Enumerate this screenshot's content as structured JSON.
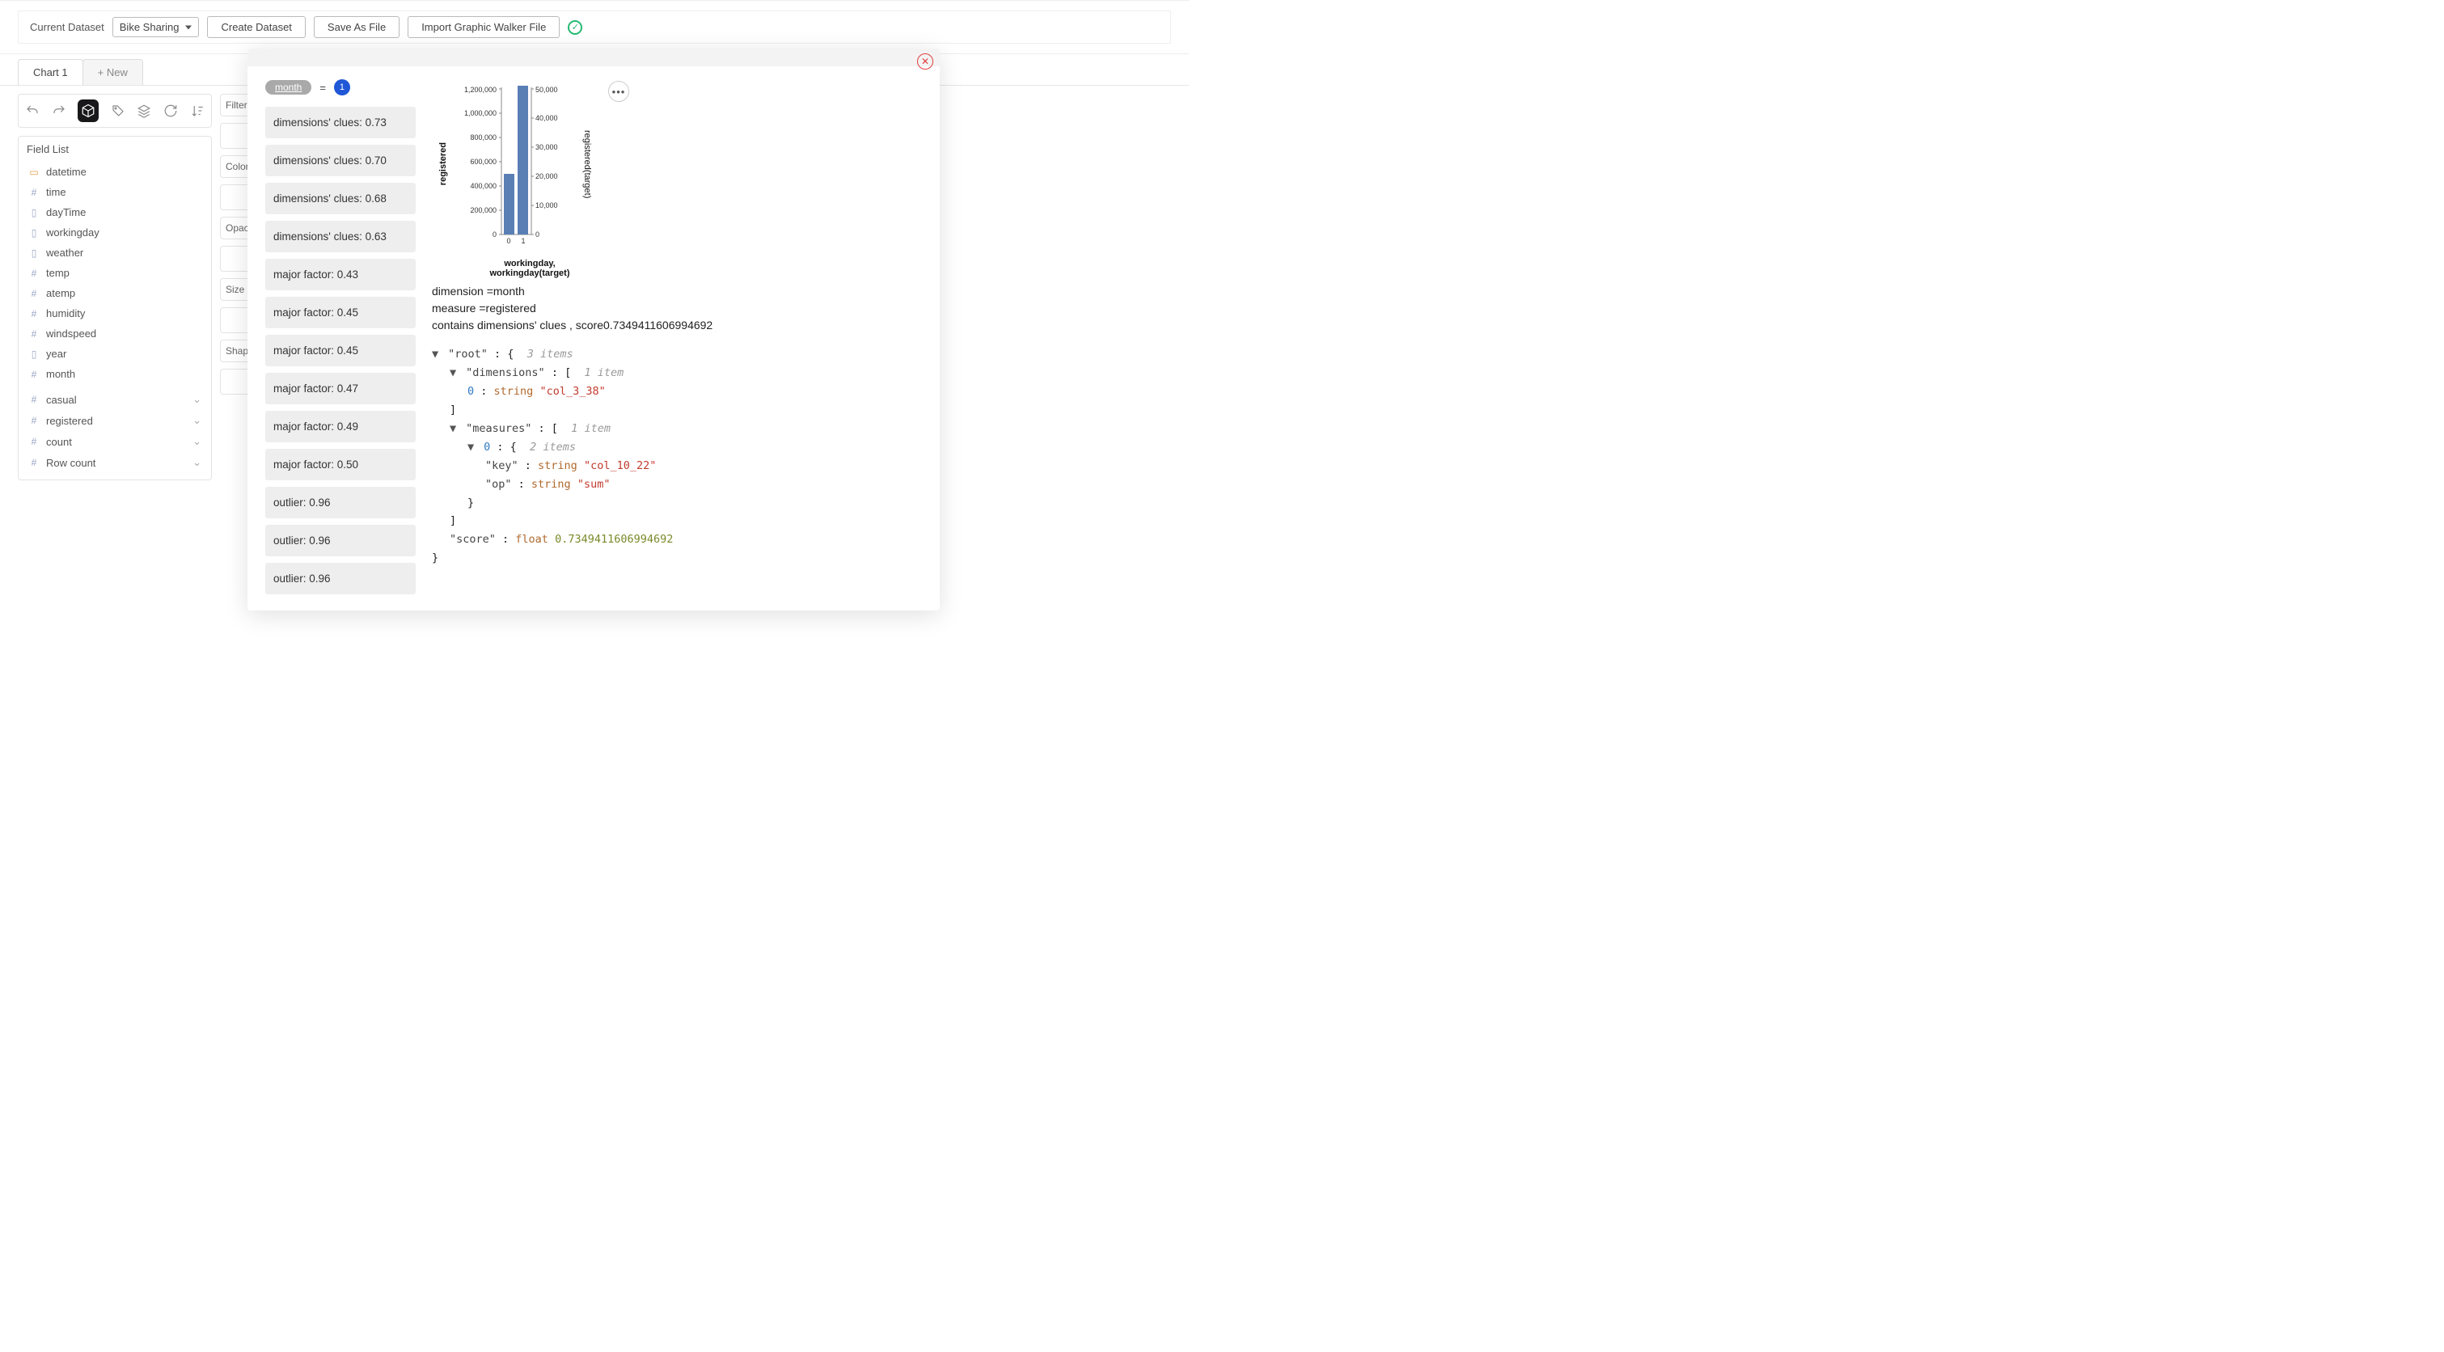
{
  "topbar": {
    "current_dataset_label": "Current Dataset",
    "dataset_selected": "Bike Sharing",
    "create_label": "Create Dataset",
    "saveas_label": "Save As File",
    "import_label": "Import Graphic Walker File"
  },
  "tabs": {
    "chart1": "Chart 1",
    "new": "+ New"
  },
  "fieldlist": {
    "title": "Field List",
    "fields": [
      {
        "icon": "cal",
        "name": "datetime"
      },
      {
        "icon": "hash",
        "name": "time"
      },
      {
        "icon": "doc",
        "name": "dayTime"
      },
      {
        "icon": "doc",
        "name": "workingday"
      },
      {
        "icon": "doc",
        "name": "weather"
      },
      {
        "icon": "hash",
        "name": "temp"
      },
      {
        "icon": "hash",
        "name": "atemp"
      },
      {
        "icon": "hash",
        "name": "humidity"
      },
      {
        "icon": "hash",
        "name": "windspeed"
      },
      {
        "icon": "doc",
        "name": "year"
      },
      {
        "icon": "hash",
        "name": "month"
      }
    ],
    "measures": [
      {
        "name": "casual"
      },
      {
        "name": "registered"
      },
      {
        "name": "count"
      },
      {
        "name": "Row count"
      }
    ]
  },
  "props": {
    "filter": "Filter",
    "color": "Color",
    "opacity": "Opacity",
    "size": "Size",
    "shape": "Shape"
  },
  "modal": {
    "chip": "month",
    "chip_val": "1",
    "clues": [
      "dimensions' clues: 0.73",
      "dimensions' clues: 0.70",
      "dimensions' clues: 0.68",
      "dimensions' clues: 0.63",
      "major factor: 0.43",
      "major factor: 0.45",
      "major factor: 0.45",
      "major factor: 0.47",
      "major factor: 0.49",
      "major factor: 0.50",
      "outlier: 0.96",
      "outlier: 0.96",
      "outlier: 0.96"
    ],
    "meta_dim": "dimension =month",
    "meta_mea": "measure =registered",
    "meta_score": "contains dimensions' clues ,  score0.7349411606994692",
    "json": {
      "root_count": "3 items",
      "dims_count": "1 item",
      "dim0": "col_3_38",
      "meas_count": "1 item",
      "m0_count": "2 items",
      "m0_key": "col_10_22",
      "m0_op": "sum",
      "score": "0.7349411606994692"
    }
  },
  "chart_data": {
    "type": "bar",
    "title": "",
    "xlabel": "workingday, workingday(target)",
    "ylabel": "registered",
    "y2label": "registered(target)",
    "categories": [
      "0",
      "1"
    ],
    "series": [
      {
        "name": "registered",
        "axis": "left",
        "values": [
          500000,
          1230000
        ]
      },
      {
        "name": "registered(target)",
        "axis": "right",
        "values": [
          20000,
          50000
        ]
      }
    ],
    "ylim": [
      0,
      1200000
    ],
    "y2lim": [
      0,
      50000
    ],
    "yticks": [
      0,
      200000,
      400000,
      600000,
      800000,
      1000000,
      1200000
    ],
    "y2ticks": [
      0,
      10000,
      20000,
      30000,
      40000,
      50000
    ]
  }
}
